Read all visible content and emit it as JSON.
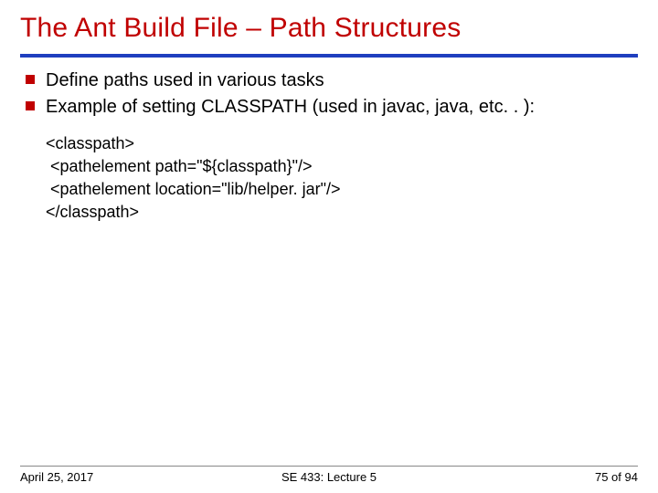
{
  "title": "The Ant Build File – Path Structures",
  "bullets": [
    "Define paths used in various tasks",
    "Example of setting CLASSPATH (used in javac, java, etc. . ):"
  ],
  "code": {
    "l1": "<classpath>",
    "l2": " <pathelement path=\"${classpath}\"/>",
    "l3": " <pathelement location=\"lib/helper. jar\"/>",
    "l4": "</classpath>"
  },
  "footer": {
    "date": "April 25, 2017",
    "course": "SE 433: Lecture 5",
    "page": "75 of 94"
  }
}
